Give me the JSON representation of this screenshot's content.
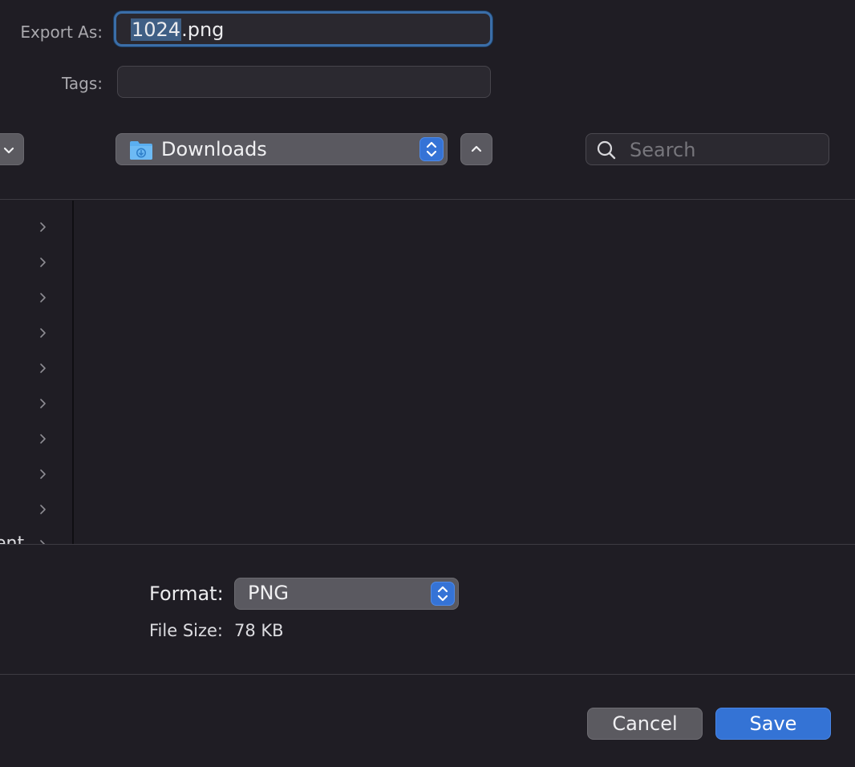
{
  "export": {
    "label": "Export As:",
    "filename_selected": "1024",
    "filename_rest": ".png"
  },
  "tags": {
    "label": "Tags:",
    "value": ""
  },
  "location": {
    "current": "Downloads"
  },
  "search": {
    "placeholder": "Search"
  },
  "sidebar": {
    "partial_text": "ent"
  },
  "format": {
    "label": "Format:",
    "selected": "PNG"
  },
  "file_size": {
    "label": "File Size:",
    "value": "78 KB"
  },
  "buttons": {
    "cancel": "Cancel",
    "save": "Save"
  },
  "colors": {
    "accent": "#3473d5",
    "background": "#1f1d24",
    "focus_ring": "#3b6ea8"
  },
  "icons": [
    "chevron-down-icon",
    "downloads-folder-icon",
    "popup-stepper-icon",
    "chevron-up-icon",
    "search-icon",
    "disclosure-chevron-icon"
  ]
}
